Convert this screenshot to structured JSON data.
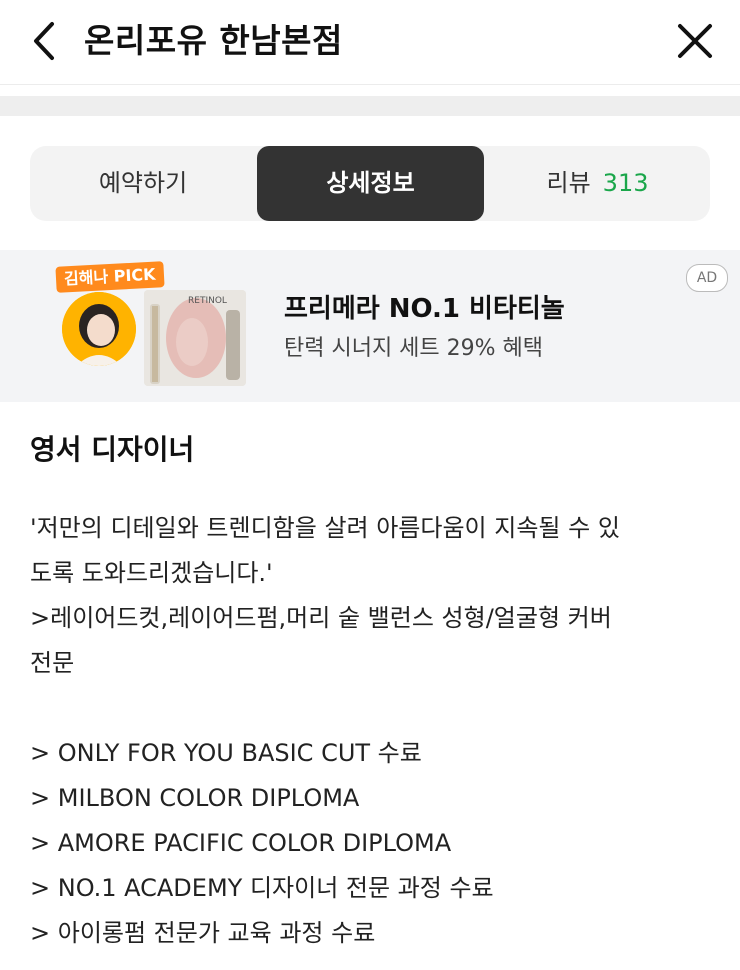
{
  "header": {
    "title": "온리포유 한남본점"
  },
  "tabs": {
    "reserve": "예약하기",
    "detail": "상세정보",
    "review": "리뷰",
    "review_count": "313"
  },
  "ad": {
    "pick_label": "김해나 PICK",
    "product_text": "RETINOL",
    "title": "프리메라 NO.1 비타티놀",
    "subtitle": "탄력 시너지 세트 29% 혜택",
    "badge": "AD"
  },
  "designer": {
    "title": "영서 디자이너",
    "lines": [
      "'저만의 디테일와 트렌디함을 살려 아름다움이 지속될 수 있",
      "도록 도와드리겠습니다.'",
      ">레이어드컷,레이어드펌,머리 숱 밸런스 성형/얼굴형 커버",
      "전문",
      "> ONLY FOR YOU BASIC CUT 수료",
      "> MILBON COLOR DIPLOMA",
      "> AMORE PACIFIC COLOR DIPLOMA",
      "> NO.1 ACADEMY 디자이너 전문 과정 수료",
      "> 아이롱펌 전문가 교육 과정 수료"
    ]
  }
}
